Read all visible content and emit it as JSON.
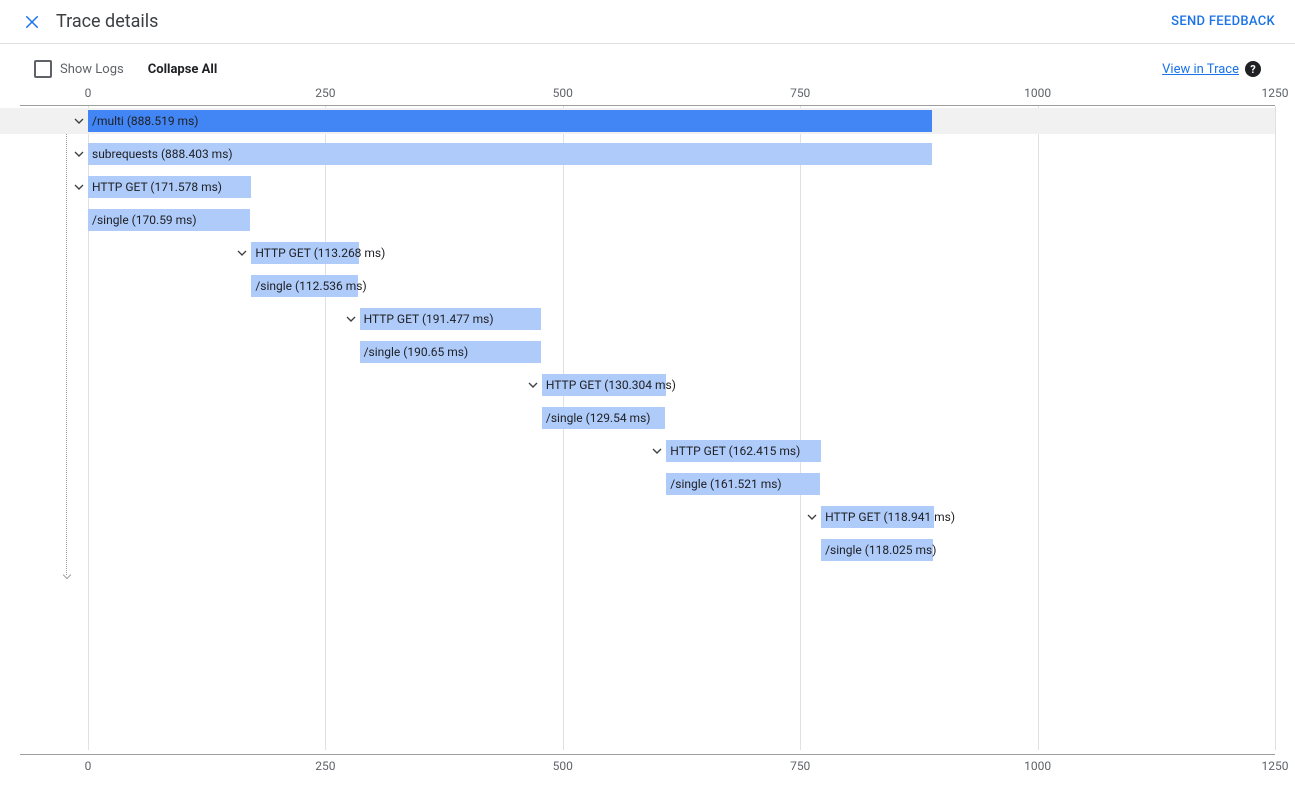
{
  "header": {
    "title": "Trace details",
    "send_feedback": "SEND FEEDBACK"
  },
  "toolbar": {
    "show_logs_label": "Show Logs",
    "collapse_all": "Collapse All",
    "view_in_trace": "View in Trace"
  },
  "axis": {
    "ticks": [
      "0",
      "250",
      "500",
      "750",
      "1000",
      "1250"
    ]
  },
  "chart_data": {
    "type": "gantt",
    "time_unit": "ms",
    "x_range": [
      0,
      1250
    ],
    "grid_values": [
      0,
      250,
      500,
      750,
      1000,
      1250
    ],
    "spans": [
      {
        "id": 0,
        "depth": 0,
        "label": "/multi (888.519 ms)",
        "start": 0,
        "duration": 888.519,
        "color": "primary",
        "has_children": true
      },
      {
        "id": 1,
        "depth": 1,
        "label": "subrequests (888.403 ms)",
        "start": 0,
        "duration": 888.403,
        "color": "secondary",
        "has_children": true
      },
      {
        "id": 2,
        "depth": 2,
        "label": "HTTP GET (171.578 ms)",
        "start": 0,
        "duration": 171.578,
        "color": "secondary",
        "has_children": true
      },
      {
        "id": 3,
        "depth": 3,
        "label": "/single (170.59 ms)",
        "start": 0,
        "duration": 170.59,
        "color": "secondary",
        "has_children": false
      },
      {
        "id": 4,
        "depth": 2,
        "label": "HTTP GET (113.268 ms)",
        "start": 172,
        "duration": 113.268,
        "color": "secondary",
        "has_children": true
      },
      {
        "id": 5,
        "depth": 3,
        "label": "/single (112.536 ms)",
        "start": 172,
        "duration": 112.536,
        "color": "secondary",
        "has_children": false
      },
      {
        "id": 6,
        "depth": 2,
        "label": "HTTP GET (191.477 ms)",
        "start": 286,
        "duration": 191.477,
        "color": "secondary",
        "has_children": true
      },
      {
        "id": 7,
        "depth": 3,
        "label": "/single (190.65 ms)",
        "start": 286,
        "duration": 190.65,
        "color": "secondary",
        "has_children": false
      },
      {
        "id": 8,
        "depth": 2,
        "label": "HTTP GET (130.304 ms)",
        "start": 478,
        "duration": 130.304,
        "color": "secondary",
        "has_children": true
      },
      {
        "id": 9,
        "depth": 3,
        "label": "/single (129.54 ms)",
        "start": 478,
        "duration": 129.54,
        "color": "secondary",
        "has_children": false
      },
      {
        "id": 10,
        "depth": 2,
        "label": "HTTP GET (162.415 ms)",
        "start": 609,
        "duration": 162.415,
        "color": "secondary",
        "has_children": true
      },
      {
        "id": 11,
        "depth": 3,
        "label": "/single (161.521 ms)",
        "start": 609,
        "duration": 161.521,
        "color": "secondary",
        "has_children": false
      },
      {
        "id": 12,
        "depth": 2,
        "label": "HTTP GET (118.941 ms)",
        "start": 772,
        "duration": 118.941,
        "color": "secondary",
        "has_children": true
      },
      {
        "id": 13,
        "depth": 3,
        "label": "/single (118.025 ms)",
        "start": 772,
        "duration": 118.025,
        "color": "secondary",
        "has_children": false
      }
    ]
  }
}
